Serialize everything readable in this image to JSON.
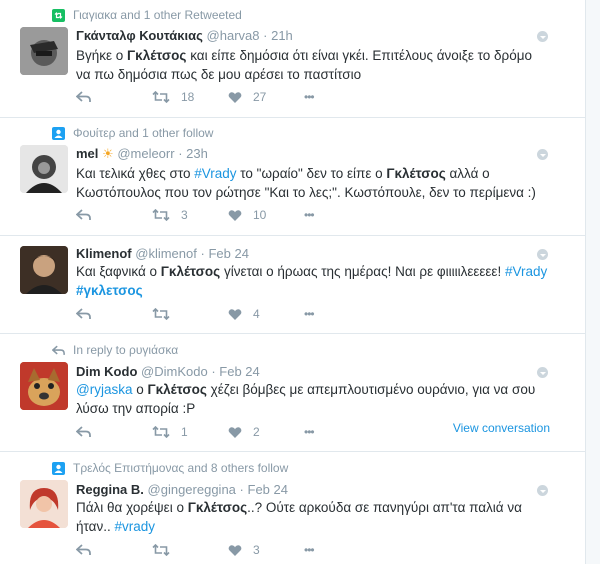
{
  "tweets": [
    {
      "context": {
        "icon": "retweet-icon",
        "text": "Γιαγιακα and 1 other Retweeted"
      },
      "fullname": "Γκάνταλφ Κουτάκιας",
      "handle": "@harva8",
      "sep": "·",
      "time": "21h",
      "text": [
        {
          "t": "Βγήκε ο "
        },
        {
          "t": "Γκλέτσος",
          "b": true
        },
        {
          "t": " και είπε δημόσια ότι είναι γκέι. Επιτέλους άνοιξε το δρόμο να πω δημόσια πως δε μου αρέσει το παστίτσιο"
        }
      ],
      "retweets": "18",
      "likes": "27",
      "reply_label": "Reply",
      "more_label": "•••"
    },
    {
      "context": {
        "icon": "follow-icon",
        "text": "Φουίτερ and 1 other follow"
      },
      "fullname": "mel",
      "name_emoji": "☀",
      "handle": "@meleorr",
      "sep": "·",
      "time": "23h",
      "text": [
        {
          "t": "Και τελικά χθες στο "
        },
        {
          "t": "#Vrady",
          "link": true
        },
        {
          "t": " το \"ωραίο\" δεν το είπε ο "
        },
        {
          "t": "Γκλέτσος",
          "b": true
        },
        {
          "t": " αλλά ο Κωστόπουλος που τον ρώτησε \"Και το λες;\". Κωστόπουλε, δεν το περίμενα :)"
        }
      ],
      "retweets": "3",
      "likes": "10",
      "more_label": "•••"
    },
    {
      "fullname": "Klimenof",
      "handle": "@klimenof",
      "sep": "·",
      "time": "Feb 24",
      "text": [
        {
          "t": "Και ξαφνικά ο "
        },
        {
          "t": "Γκλέτσος",
          "b": true
        },
        {
          "t": " γίνεται ο ήρωας της ημέρας! Ναι ρε φιιιιιλεεεεε! "
        },
        {
          "t": "#Vrady",
          "link": true
        },
        {
          "t": " "
        },
        {
          "t": "#γκλετσος",
          "link": true,
          "b": true
        }
      ],
      "retweets": "",
      "likes": "4",
      "more_label": "•••"
    },
    {
      "context": {
        "icon": "reply-icon",
        "text": "In reply to ρυγιάσκα"
      },
      "fullname": "Dim Kodo",
      "handle": "@DimKodo",
      "sep": "·",
      "time": "Feb 24",
      "text": [
        {
          "t": "@ryjaska",
          "link": true
        },
        {
          "t": " ο "
        },
        {
          "t": "Γκλέτσος",
          "b": true
        },
        {
          "t": " χέζει βόμβες με απεμπλουτισμένο ουράνιο, για να σου λύσω την απορία :P"
        }
      ],
      "retweets": "1",
      "likes": "2",
      "view_conversation": "View conversation",
      "more_label": "•••"
    },
    {
      "context": {
        "icon": "follow-icon",
        "text": "Τρελός Επιστήμονας and 8 others follow"
      },
      "fullname": "Reggina B.",
      "handle": "@gingereggina",
      "sep": "·",
      "time": "Feb 24",
      "text": [
        {
          "t": "Πάλι θα χορέψει ο "
        },
        {
          "t": "Γκλέτσος",
          "b": true
        },
        {
          "t": "..? Ούτε αρκούδα σε πανηγύρι απ'τα παλιά να ήταν.. "
        },
        {
          "t": "#vrady",
          "link": true
        }
      ],
      "retweets": "",
      "likes": "3",
      "more_label": "•••"
    }
  ],
  "colors": {
    "link": "#1b95e0",
    "meta": "#8899a6",
    "retweet_context": "#17bf63",
    "follow_context": "#1da1f2"
  }
}
